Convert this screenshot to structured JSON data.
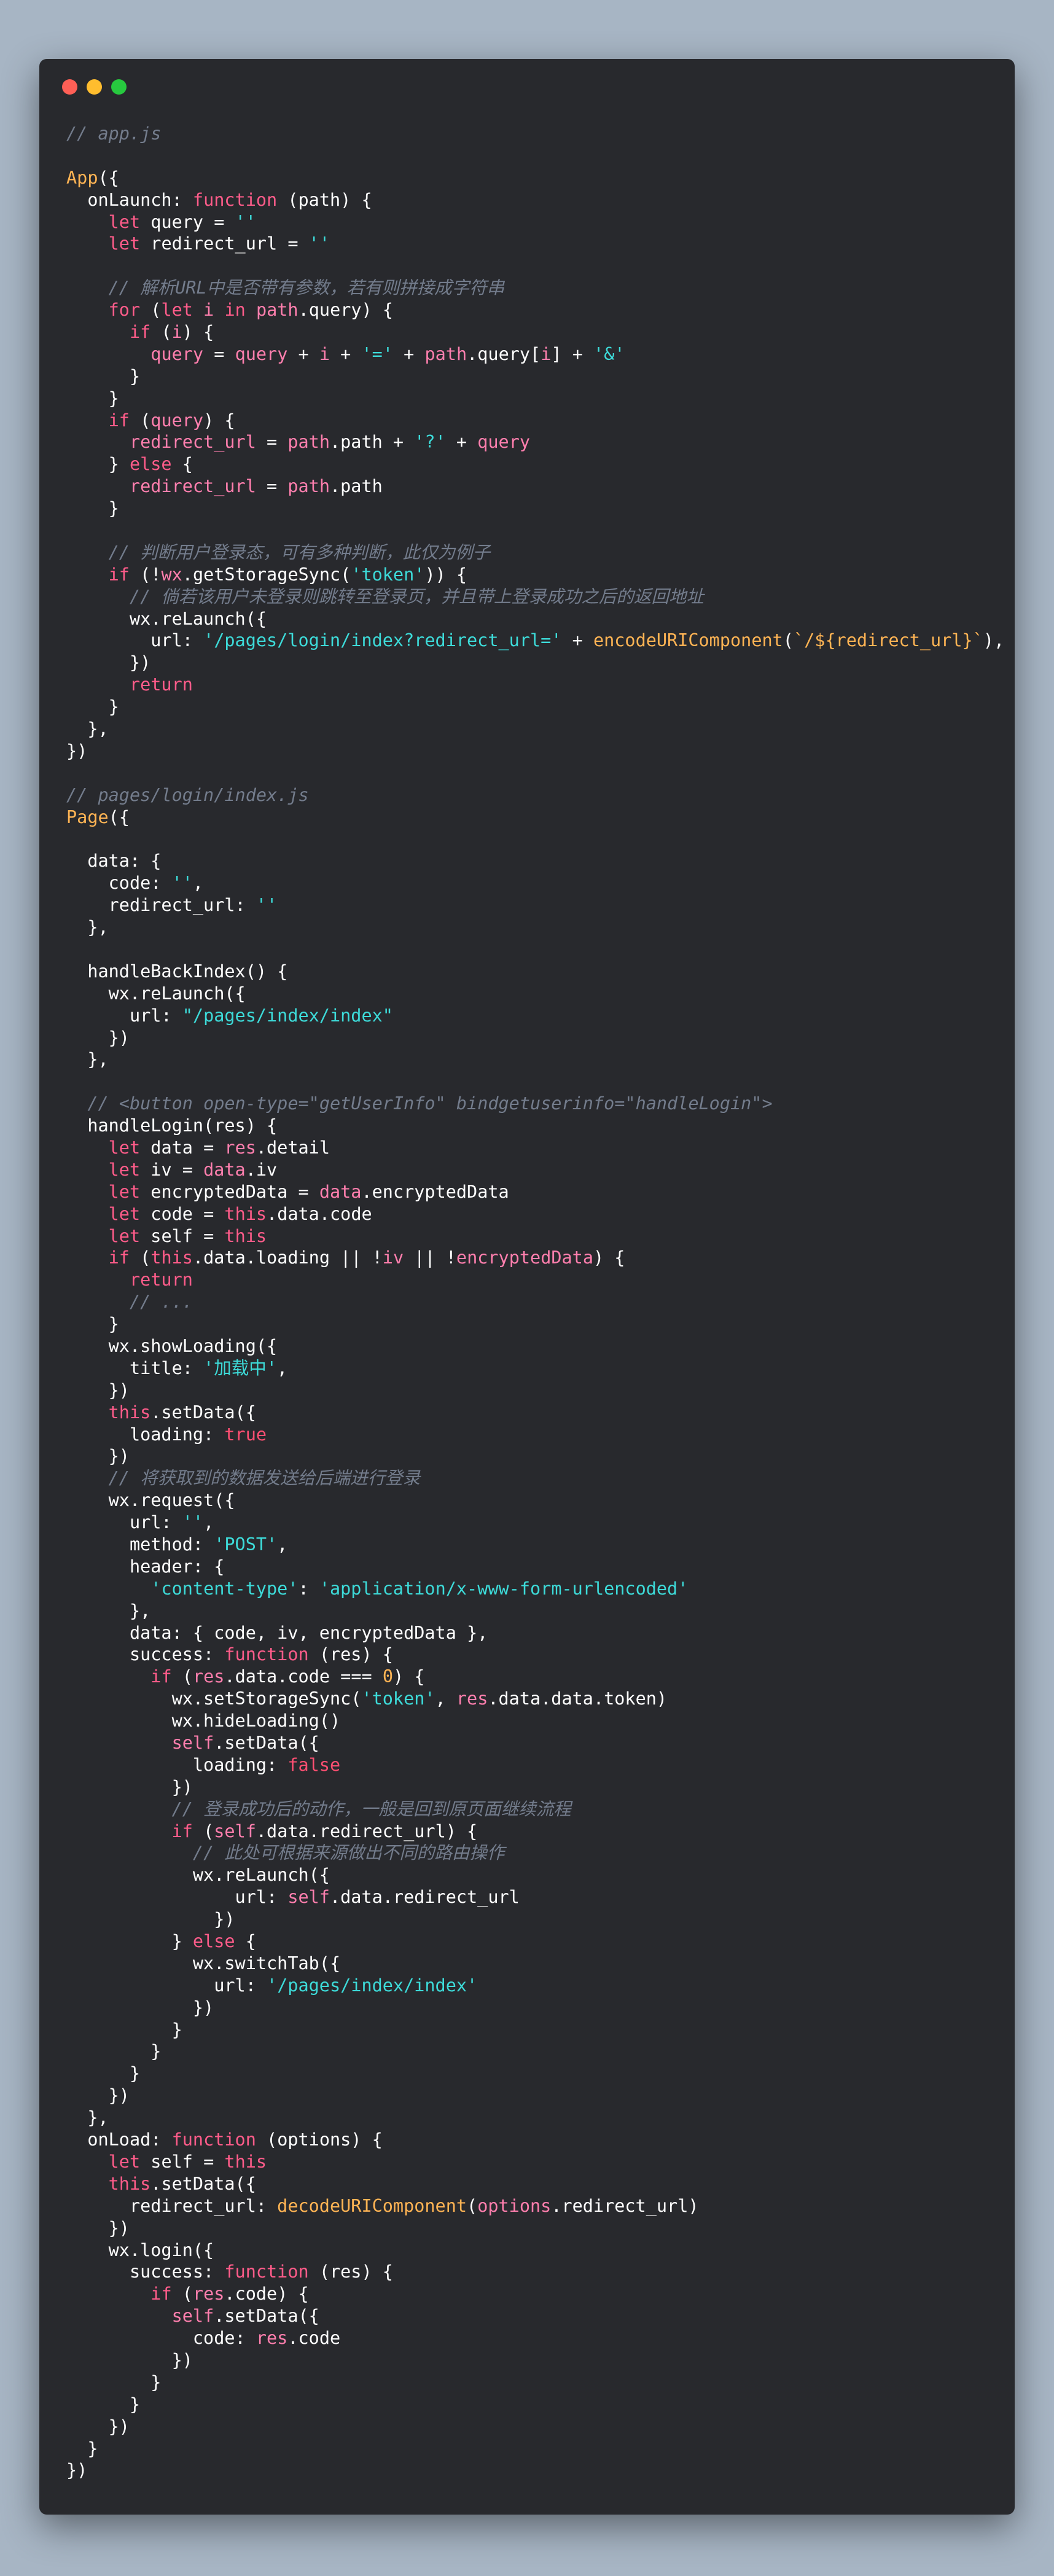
{
  "window": {
    "dots": [
      {
        "name": "close-dot",
        "color": "#ff5f56"
      },
      {
        "name": "minimize-dot",
        "color": "#ffbd2e"
      },
      {
        "name": "maximize-dot",
        "color": "#27c93f"
      }
    ]
  },
  "colors": {
    "background": "#a7b5c4",
    "window": "#28292d",
    "plain": "#ffffff",
    "comment": "#737c8c",
    "keyword": "#ff5c8a",
    "string": "#3ddbd9",
    "identifier": "#ff7fae",
    "function": "#ffb454",
    "boolean": "#ff4f72"
  },
  "code_lines": [
    [
      [
        "comment",
        "// app.js"
      ]
    ],
    [],
    [
      [
        "func",
        "App"
      ],
      [
        "plain",
        "({"
      ]
    ],
    [
      [
        "plain",
        "  onLaunch: "
      ],
      [
        "keyword",
        "function"
      ],
      [
        "plain",
        " (path) {"
      ]
    ],
    [
      [
        "plain",
        "    "
      ],
      [
        "keyword",
        "let"
      ],
      [
        "plain",
        " query = "
      ],
      [
        "string",
        "''"
      ]
    ],
    [
      [
        "plain",
        "    "
      ],
      [
        "keyword",
        "let"
      ],
      [
        "plain",
        " redirect_url = "
      ],
      [
        "string",
        "''"
      ]
    ],
    [],
    [
      [
        "plain",
        "    "
      ],
      [
        "comment",
        "// 解析URL中是否带有参数，若有则拼接成字符串"
      ]
    ],
    [
      [
        "plain",
        "    "
      ],
      [
        "keyword",
        "for"
      ],
      [
        "plain",
        " ("
      ],
      [
        "keyword",
        "let"
      ],
      [
        "plain",
        " "
      ],
      [
        "ident",
        "i"
      ],
      [
        "plain",
        " "
      ],
      [
        "keyword",
        "in"
      ],
      [
        "plain",
        " "
      ],
      [
        "ident",
        "path"
      ],
      [
        "plain",
        ".query) {"
      ]
    ],
    [
      [
        "plain",
        "      "
      ],
      [
        "keyword",
        "if"
      ],
      [
        "plain",
        " ("
      ],
      [
        "ident",
        "i"
      ],
      [
        "plain",
        ") {"
      ]
    ],
    [
      [
        "plain",
        "        "
      ],
      [
        "ident",
        "query"
      ],
      [
        "plain",
        " = "
      ],
      [
        "ident",
        "query"
      ],
      [
        "plain",
        " + "
      ],
      [
        "ident",
        "i"
      ],
      [
        "plain",
        " + "
      ],
      [
        "string",
        "'='"
      ],
      [
        "plain",
        " + "
      ],
      [
        "ident",
        "path"
      ],
      [
        "plain",
        ".query["
      ],
      [
        "ident",
        "i"
      ],
      [
        "plain",
        "] + "
      ],
      [
        "string",
        "'&'"
      ]
    ],
    [
      [
        "plain",
        "      }"
      ]
    ],
    [
      [
        "plain",
        "    }"
      ]
    ],
    [
      [
        "plain",
        "    "
      ],
      [
        "keyword",
        "if"
      ],
      [
        "plain",
        " ("
      ],
      [
        "ident",
        "query"
      ],
      [
        "plain",
        ") {"
      ]
    ],
    [
      [
        "plain",
        "      "
      ],
      [
        "ident",
        "redirect_url"
      ],
      [
        "plain",
        " = "
      ],
      [
        "ident",
        "path"
      ],
      [
        "plain",
        ".path + "
      ],
      [
        "string",
        "'?'"
      ],
      [
        "plain",
        " + "
      ],
      [
        "ident",
        "query"
      ]
    ],
    [
      [
        "plain",
        "    } "
      ],
      [
        "keyword",
        "else"
      ],
      [
        "plain",
        " {"
      ]
    ],
    [
      [
        "plain",
        "      "
      ],
      [
        "ident",
        "redirect_url"
      ],
      [
        "plain",
        " = "
      ],
      [
        "ident",
        "path"
      ],
      [
        "plain",
        ".path"
      ]
    ],
    [
      [
        "plain",
        "    }"
      ]
    ],
    [],
    [
      [
        "plain",
        "    "
      ],
      [
        "comment",
        "// 判断用户登录态，可有多种判断，此仅为例子"
      ]
    ],
    [
      [
        "plain",
        "    "
      ],
      [
        "keyword",
        "if"
      ],
      [
        "plain",
        " (!"
      ],
      [
        "ident",
        "wx"
      ],
      [
        "plain",
        ".getStorageSync("
      ],
      [
        "string",
        "'token'"
      ],
      [
        "plain",
        ")) {"
      ]
    ],
    [
      [
        "plain",
        "      "
      ],
      [
        "comment",
        "// 倘若该用户未登录则跳转至登录页，并且带上登录成功之后的返回地址"
      ]
    ],
    [
      [
        "plain",
        "      wx.reLaunch({"
      ]
    ],
    [
      [
        "plain",
        "        url: "
      ],
      [
        "string",
        "'/pages/login/index?redirect_url='"
      ],
      [
        "plain",
        " + "
      ],
      [
        "func",
        "encodeURIComponent"
      ],
      [
        "plain",
        "("
      ],
      [
        "func",
        "`/${redirect_url}`"
      ],
      [
        "plain",
        "),"
      ]
    ],
    [
      [
        "plain",
        "      })"
      ]
    ],
    [
      [
        "plain",
        "      "
      ],
      [
        "keyword",
        "return"
      ]
    ],
    [
      [
        "plain",
        "    }"
      ]
    ],
    [
      [
        "plain",
        "  },"
      ]
    ],
    [
      [
        "plain",
        "})"
      ]
    ],
    [],
    [
      [
        "comment",
        "// pages/login/index.js"
      ]
    ],
    [
      [
        "func",
        "Page"
      ],
      [
        "plain",
        "({"
      ]
    ],
    [],
    [
      [
        "plain",
        "  data: {"
      ]
    ],
    [
      [
        "plain",
        "    code: "
      ],
      [
        "string",
        "''"
      ],
      [
        "plain",
        ","
      ]
    ],
    [
      [
        "plain",
        "    redirect_url: "
      ],
      [
        "string",
        "''"
      ]
    ],
    [
      [
        "plain",
        "  },"
      ]
    ],
    [],
    [
      [
        "plain",
        "  handleBackIndex() {"
      ]
    ],
    [
      [
        "plain",
        "    wx.reLaunch({"
      ]
    ],
    [
      [
        "plain",
        "      url: "
      ],
      [
        "string",
        "\"/pages/index/index\""
      ]
    ],
    [
      [
        "plain",
        "    })"
      ]
    ],
    [
      [
        "plain",
        "  },"
      ]
    ],
    [],
    [
      [
        "plain",
        "  "
      ],
      [
        "comment",
        "// <button open-type=\"getUserInfo\" bindgetuserinfo=\"handleLogin\">"
      ]
    ],
    [
      [
        "plain",
        "  handleLogin(res) {"
      ]
    ],
    [
      [
        "plain",
        "    "
      ],
      [
        "keyword",
        "let"
      ],
      [
        "plain",
        " data = "
      ],
      [
        "ident",
        "res"
      ],
      [
        "plain",
        ".detail"
      ]
    ],
    [
      [
        "plain",
        "    "
      ],
      [
        "keyword",
        "let"
      ],
      [
        "plain",
        " iv = "
      ],
      [
        "ident",
        "data"
      ],
      [
        "plain",
        ".iv"
      ]
    ],
    [
      [
        "plain",
        "    "
      ],
      [
        "keyword",
        "let"
      ],
      [
        "plain",
        " encryptedData = "
      ],
      [
        "ident",
        "data"
      ],
      [
        "plain",
        ".encryptedData"
      ]
    ],
    [
      [
        "plain",
        "    "
      ],
      [
        "keyword",
        "let"
      ],
      [
        "plain",
        " code = "
      ],
      [
        "keyword",
        "this"
      ],
      [
        "plain",
        ".data.code"
      ]
    ],
    [
      [
        "plain",
        "    "
      ],
      [
        "keyword",
        "let"
      ],
      [
        "plain",
        " self = "
      ],
      [
        "keyword",
        "this"
      ]
    ],
    [
      [
        "plain",
        "    "
      ],
      [
        "keyword",
        "if"
      ],
      [
        "plain",
        " ("
      ],
      [
        "keyword",
        "this"
      ],
      [
        "plain",
        ".data.loading || !"
      ],
      [
        "ident",
        "iv"
      ],
      [
        "plain",
        " || !"
      ],
      [
        "ident",
        "encryptedData"
      ],
      [
        "plain",
        ") {"
      ]
    ],
    [
      [
        "plain",
        "      "
      ],
      [
        "keyword",
        "return"
      ]
    ],
    [
      [
        "plain",
        "      "
      ],
      [
        "comment",
        "// ..."
      ]
    ],
    [
      [
        "plain",
        "    }"
      ]
    ],
    [
      [
        "plain",
        "    wx.showLoading({"
      ]
    ],
    [
      [
        "plain",
        "      title: "
      ],
      [
        "string",
        "'加载中'"
      ],
      [
        "plain",
        ","
      ]
    ],
    [
      [
        "plain",
        "    })"
      ]
    ],
    [
      [
        "plain",
        "    "
      ],
      [
        "keyword",
        "this"
      ],
      [
        "plain",
        ".setData({"
      ]
    ],
    [
      [
        "plain",
        "      loading: "
      ],
      [
        "bool",
        "true"
      ]
    ],
    [
      [
        "plain",
        "    })"
      ]
    ],
    [
      [
        "plain",
        "    "
      ],
      [
        "comment",
        "// 将获取到的数据发送给后端进行登录"
      ]
    ],
    [
      [
        "plain",
        "    wx.request({"
      ]
    ],
    [
      [
        "plain",
        "      url: "
      ],
      [
        "string",
        "''"
      ],
      [
        "plain",
        ","
      ]
    ],
    [
      [
        "plain",
        "      method: "
      ],
      [
        "string",
        "'POST'"
      ],
      [
        "plain",
        ","
      ]
    ],
    [
      [
        "plain",
        "      header: {"
      ]
    ],
    [
      [
        "plain",
        "        "
      ],
      [
        "string",
        "'content-type'"
      ],
      [
        "plain",
        ": "
      ],
      [
        "string",
        "'application/x-www-form-urlencoded'"
      ]
    ],
    [
      [
        "plain",
        "      },"
      ]
    ],
    [
      [
        "plain",
        "      data: { code, iv, encryptedData },"
      ]
    ],
    [
      [
        "plain",
        "      success: "
      ],
      [
        "keyword",
        "function"
      ],
      [
        "plain",
        " (res) {"
      ]
    ],
    [
      [
        "plain",
        "        "
      ],
      [
        "keyword",
        "if"
      ],
      [
        "plain",
        " ("
      ],
      [
        "ident",
        "res"
      ],
      [
        "plain",
        ".data.code === "
      ],
      [
        "number",
        "0"
      ],
      [
        "plain",
        ") {"
      ]
    ],
    [
      [
        "plain",
        "          wx.setStorageSync("
      ],
      [
        "string",
        "'token'"
      ],
      [
        "plain",
        ", "
      ],
      [
        "ident",
        "res"
      ],
      [
        "plain",
        ".data.data.token)"
      ]
    ],
    [
      [
        "plain",
        "          wx.hideLoading()"
      ]
    ],
    [
      [
        "plain",
        "          "
      ],
      [
        "ident",
        "self"
      ],
      [
        "plain",
        ".setData({"
      ]
    ],
    [
      [
        "plain",
        "            loading: "
      ],
      [
        "bool",
        "false"
      ]
    ],
    [
      [
        "plain",
        "          })"
      ]
    ],
    [
      [
        "plain",
        "          "
      ],
      [
        "comment",
        "// 登录成功后的动作，一般是回到原页面继续流程"
      ]
    ],
    [
      [
        "plain",
        "          "
      ],
      [
        "keyword",
        "if"
      ],
      [
        "plain",
        " ("
      ],
      [
        "ident",
        "self"
      ],
      [
        "plain",
        ".data.redirect_url) {"
      ]
    ],
    [
      [
        "plain",
        "            "
      ],
      [
        "comment",
        "// 此处可根据来源做出不同的路由操作"
      ]
    ],
    [
      [
        "plain",
        "            wx.reLaunch({"
      ]
    ],
    [
      [
        "plain",
        "                url: "
      ],
      [
        "ident",
        "self"
      ],
      [
        "plain",
        ".data.redirect_url"
      ]
    ],
    [
      [
        "plain",
        "              })"
      ]
    ],
    [
      [
        "plain",
        "          } "
      ],
      [
        "keyword",
        "else"
      ],
      [
        "plain",
        " {"
      ]
    ],
    [
      [
        "plain",
        "            wx.switchTab({"
      ]
    ],
    [
      [
        "plain",
        "              url: "
      ],
      [
        "string",
        "'/pages/index/index'"
      ]
    ],
    [
      [
        "plain",
        "            })"
      ]
    ],
    [
      [
        "plain",
        "          }"
      ]
    ],
    [
      [
        "plain",
        "        }"
      ]
    ],
    [
      [
        "plain",
        "      }"
      ]
    ],
    [
      [
        "plain",
        "    })"
      ]
    ],
    [
      [
        "plain",
        "  },"
      ]
    ],
    [
      [
        "plain",
        "  onLoad: "
      ],
      [
        "keyword",
        "function"
      ],
      [
        "plain",
        " (options) {"
      ]
    ],
    [
      [
        "plain",
        "    "
      ],
      [
        "keyword",
        "let"
      ],
      [
        "plain",
        " self = "
      ],
      [
        "keyword",
        "this"
      ]
    ],
    [
      [
        "plain",
        "    "
      ],
      [
        "keyword",
        "this"
      ],
      [
        "plain",
        ".setData({"
      ]
    ],
    [
      [
        "plain",
        "      redirect_url: "
      ],
      [
        "func",
        "decodeURIComponent"
      ],
      [
        "plain",
        "("
      ],
      [
        "ident",
        "options"
      ],
      [
        "plain",
        ".redirect_url)"
      ]
    ],
    [
      [
        "plain",
        "    })"
      ]
    ],
    [
      [
        "plain",
        "    wx.login({"
      ]
    ],
    [
      [
        "plain",
        "      success: "
      ],
      [
        "keyword",
        "function"
      ],
      [
        "plain",
        " (res) {"
      ]
    ],
    [
      [
        "plain",
        "        "
      ],
      [
        "keyword",
        "if"
      ],
      [
        "plain",
        " ("
      ],
      [
        "ident",
        "res"
      ],
      [
        "plain",
        ".code) {"
      ]
    ],
    [
      [
        "plain",
        "          "
      ],
      [
        "ident",
        "self"
      ],
      [
        "plain",
        ".setData({"
      ]
    ],
    [
      [
        "plain",
        "            code: "
      ],
      [
        "ident",
        "res"
      ],
      [
        "plain",
        ".code"
      ]
    ],
    [
      [
        "plain",
        "          })"
      ]
    ],
    [
      [
        "plain",
        "        }"
      ]
    ],
    [
      [
        "plain",
        "      }"
      ]
    ],
    [
      [
        "plain",
        "    })"
      ]
    ],
    [
      [
        "plain",
        "  }"
      ]
    ],
    [
      [
        "plain",
        "})"
      ]
    ]
  ]
}
